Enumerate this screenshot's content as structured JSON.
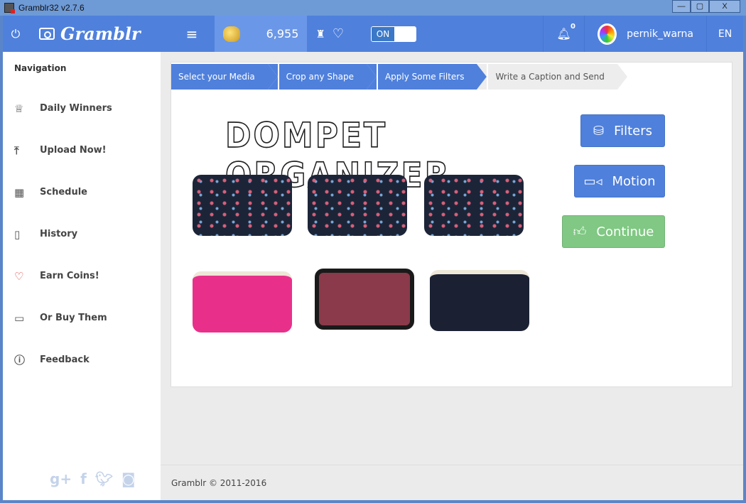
{
  "window": {
    "title": "Gramblr32 v2.7.6",
    "minimize": "—",
    "maximize": "▢",
    "close": "X"
  },
  "topbar": {
    "logo": "Gramblr",
    "coins": "6,955",
    "toggle": "ON",
    "notifications": "0",
    "username": "pernik_warna",
    "language": "EN"
  },
  "sidebar": {
    "title": "Navigation",
    "items": [
      {
        "label": "Daily Winners",
        "icon": "trophy-icon"
      },
      {
        "label": "Upload Now!",
        "icon": "upload-icon"
      },
      {
        "label": "Schedule",
        "icon": "calendar-icon"
      },
      {
        "label": "History",
        "icon": "book-icon"
      },
      {
        "label": "Earn Coins!",
        "icon": "heart-icon"
      },
      {
        "label": "Or Buy Them",
        "icon": "wallet-icon"
      },
      {
        "label": "Feedback",
        "icon": "help-icon"
      }
    ],
    "social": [
      "g+",
      "f",
      "twitter",
      "instagram"
    ]
  },
  "steps": [
    {
      "label": "Select your Media",
      "done": true
    },
    {
      "label": "Crop any Shape",
      "done": true
    },
    {
      "label": "Apply Some Filters",
      "done": true
    },
    {
      "label": "Write a Caption and Send",
      "done": false
    }
  ],
  "image": {
    "lettering": "DOMPET ORGANIZER"
  },
  "buttons": {
    "filters": "Filters",
    "motion": "Motion",
    "continue": "Continue"
  },
  "footer": {
    "text": "Gramblr © 2011-2016"
  },
  "colors": {
    "accent": "#4f80dc",
    "continue": "#80c883"
  }
}
